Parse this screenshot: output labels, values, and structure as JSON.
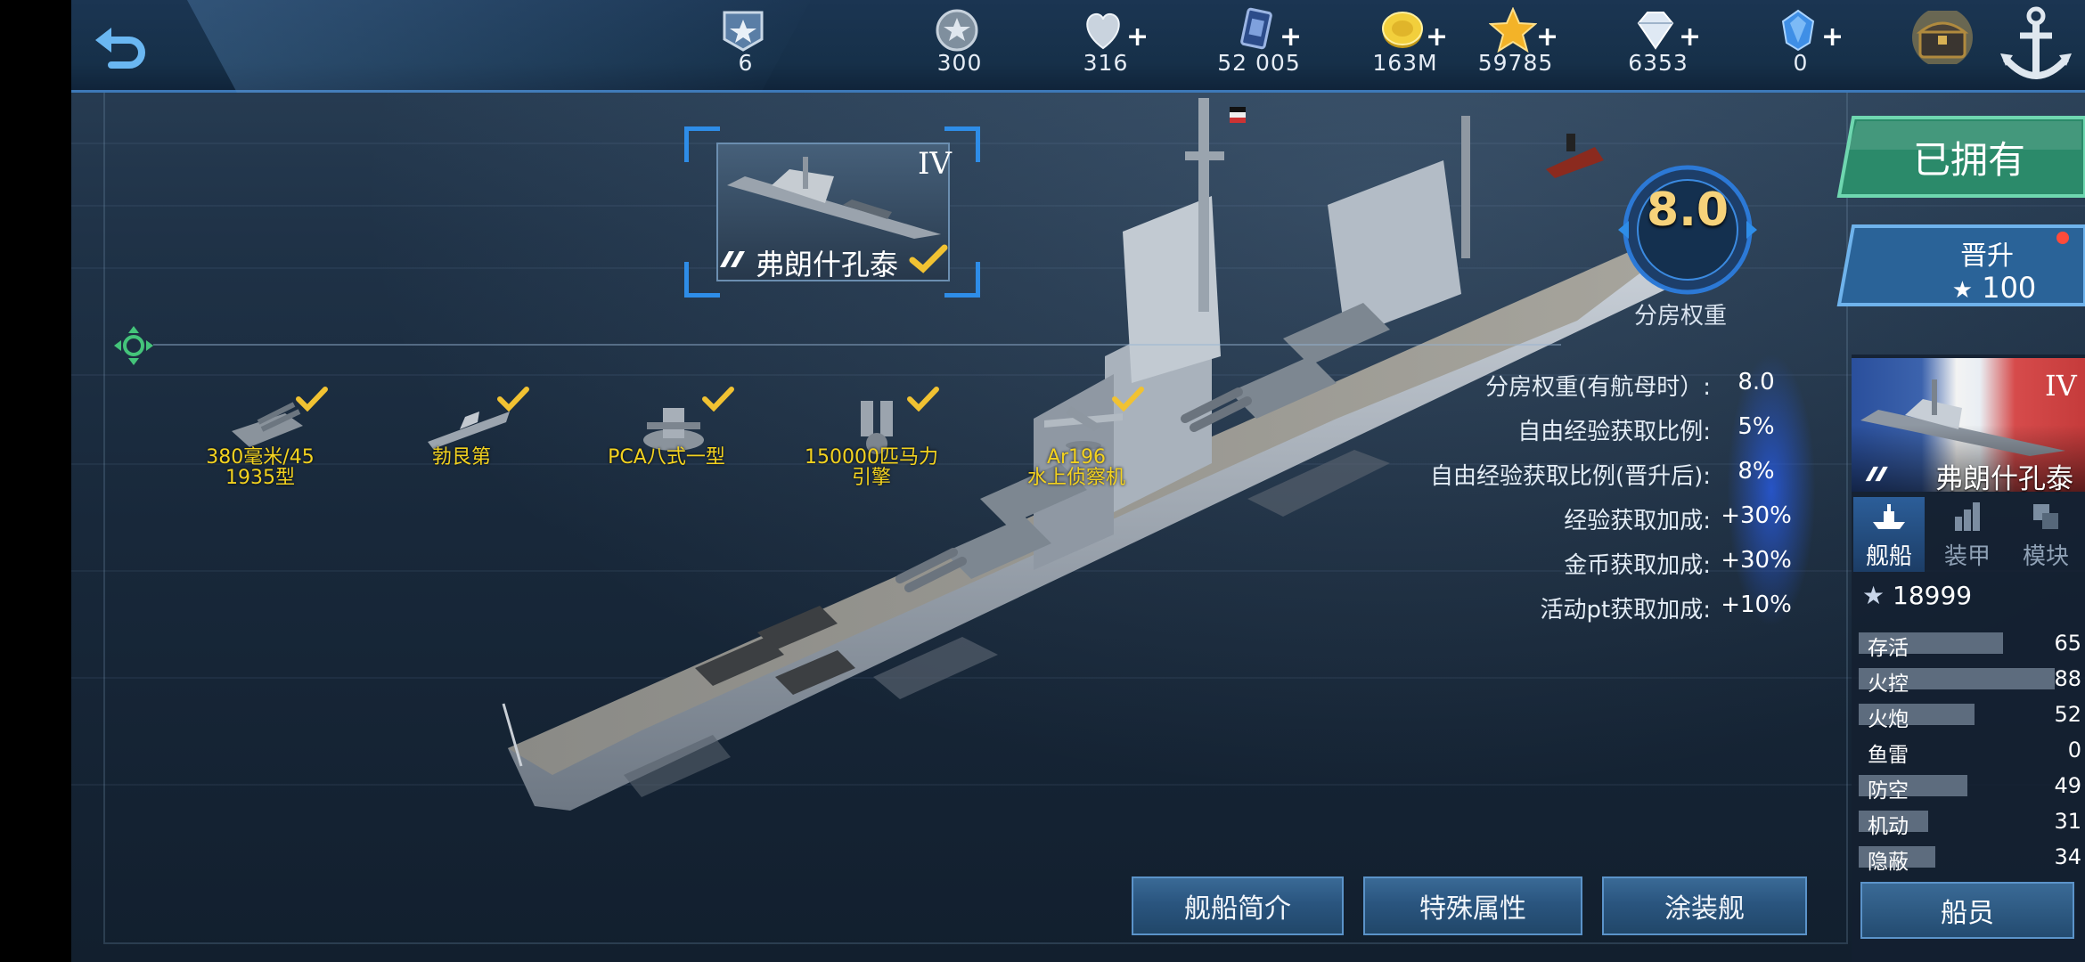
{
  "topbar": {
    "back_icon": "back-arrow-icon",
    "resources": [
      {
        "name": "rank",
        "icon": "rank-badge-icon",
        "value": "6",
        "has_plus": false
      },
      {
        "name": "silver",
        "icon": "silver-star-coin-icon",
        "value": "300",
        "has_plus": false
      },
      {
        "name": "fuel",
        "icon": "heart-icon",
        "value": "316",
        "has_plus": true
      },
      {
        "name": "cards",
        "icon": "card-icon",
        "value": "52 005",
        "has_plus": true
      },
      {
        "name": "gold",
        "icon": "gold-coin-icon",
        "value": "163M",
        "has_plus": true
      },
      {
        "name": "stars",
        "icon": "gold-star-icon",
        "value": "59785",
        "has_plus": true
      },
      {
        "name": "diamond",
        "icon": "diamond-icon",
        "value": "6353",
        "has_plus": true
      },
      {
        "name": "crystal",
        "icon": "blue-crystal-icon",
        "value": "0",
        "has_plus": true
      }
    ],
    "chest_icon": "treasure-chest-icon",
    "anchor_icon": "anchor-icon"
  },
  "ship_card": {
    "tier": "IV",
    "name": "弗朗什孔泰"
  },
  "equipment": [
    {
      "label_line1": "380毫米/45",
      "label_line2": "1935型",
      "icon": "main-gun-turret-icon"
    },
    {
      "label_line1": "勃艮第",
      "label_line2": "",
      "icon": "hull-icon"
    },
    {
      "label_line1": "PCA八式一型",
      "label_line2": "",
      "icon": "fire-control-icon"
    },
    {
      "label_line1": "150000匹马力",
      "label_line2": "引擎",
      "icon": "engine-icon"
    },
    {
      "label_line1": "Ar196",
      "label_line2": "水上侦察机",
      "icon": "seaplane-icon"
    }
  ],
  "weight": {
    "value": "8.0",
    "label": "分房权重"
  },
  "stats": [
    {
      "label": "分房权重(有航母时）:",
      "value": "8.0"
    },
    {
      "label": "自由经验获取比例:",
      "value": "5%"
    },
    {
      "label": "自由经验获取比例(晋升后):",
      "value": "8%"
    },
    {
      "label": "经验获取加成:",
      "value": "+30%"
    },
    {
      "label": "金币获取加成:",
      "value": "+30%"
    },
    {
      "label": "活动pt获取加成:",
      "value": "+10%"
    }
  ],
  "bottom_buttons": {
    "intro": "舰船简介",
    "special": "特殊属性",
    "paint": "涂装舰"
  },
  "right_panel": {
    "owned": "已拥有",
    "promote_label": "晋升",
    "promote_cost": "100",
    "flag_tier": "IV",
    "flag_name": "弗朗什孔泰",
    "tabs": [
      {
        "label": "舰船",
        "icon": "ship-tab-icon",
        "active": true
      },
      {
        "label": "装甲",
        "icon": "armor-tab-icon",
        "active": false
      },
      {
        "label": "模块",
        "icon": "module-tab-icon",
        "active": false
      }
    ],
    "score": "18999",
    "attributes": [
      {
        "name": "存活",
        "value": "65",
        "ratio": 0.65
      },
      {
        "name": "火控",
        "value": "88",
        "ratio": 0.88
      },
      {
        "name": "火炮",
        "value": "52",
        "ratio": 0.52
      },
      {
        "name": "鱼雷",
        "value": "0",
        "ratio": 0
      },
      {
        "name": "防空",
        "value": "49",
        "ratio": 0.49
      },
      {
        "name": "机动",
        "value": "31",
        "ratio": 0.31
      },
      {
        "name": "隐蔽",
        "value": "34",
        "ratio": 0.34
      }
    ],
    "crew": "船员"
  },
  "colors": {
    "accent": "#3d79b8",
    "gold_text": "#f3d21f",
    "check": "#f1c232",
    "stat_glow": "#2a5ad8"
  }
}
